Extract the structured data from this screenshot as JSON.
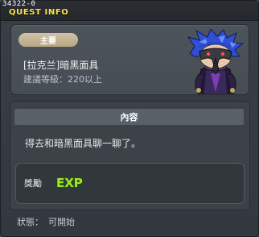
{
  "window": {
    "quest_id": "34322-0",
    "title": "QUEST INFO"
  },
  "quest": {
    "badge": "主要",
    "name": "[拉克兰]暗黑面具",
    "level_requirement": "建議等級：220以上"
  },
  "content": {
    "header": "內容",
    "description": "得去和暗黑面具聊一聊了。"
  },
  "reward": {
    "label": "獎勵",
    "exp_text": "EXP"
  },
  "status": {
    "label": "狀態：",
    "value": "可開始"
  },
  "colors": {
    "title": "#ffe14a",
    "badge": "#c6b695",
    "exp_fill": "#9ee62a",
    "background": "#3a3f45"
  },
  "icons": [
    "npc-portrait-dark-mask",
    "exp-icon"
  ]
}
